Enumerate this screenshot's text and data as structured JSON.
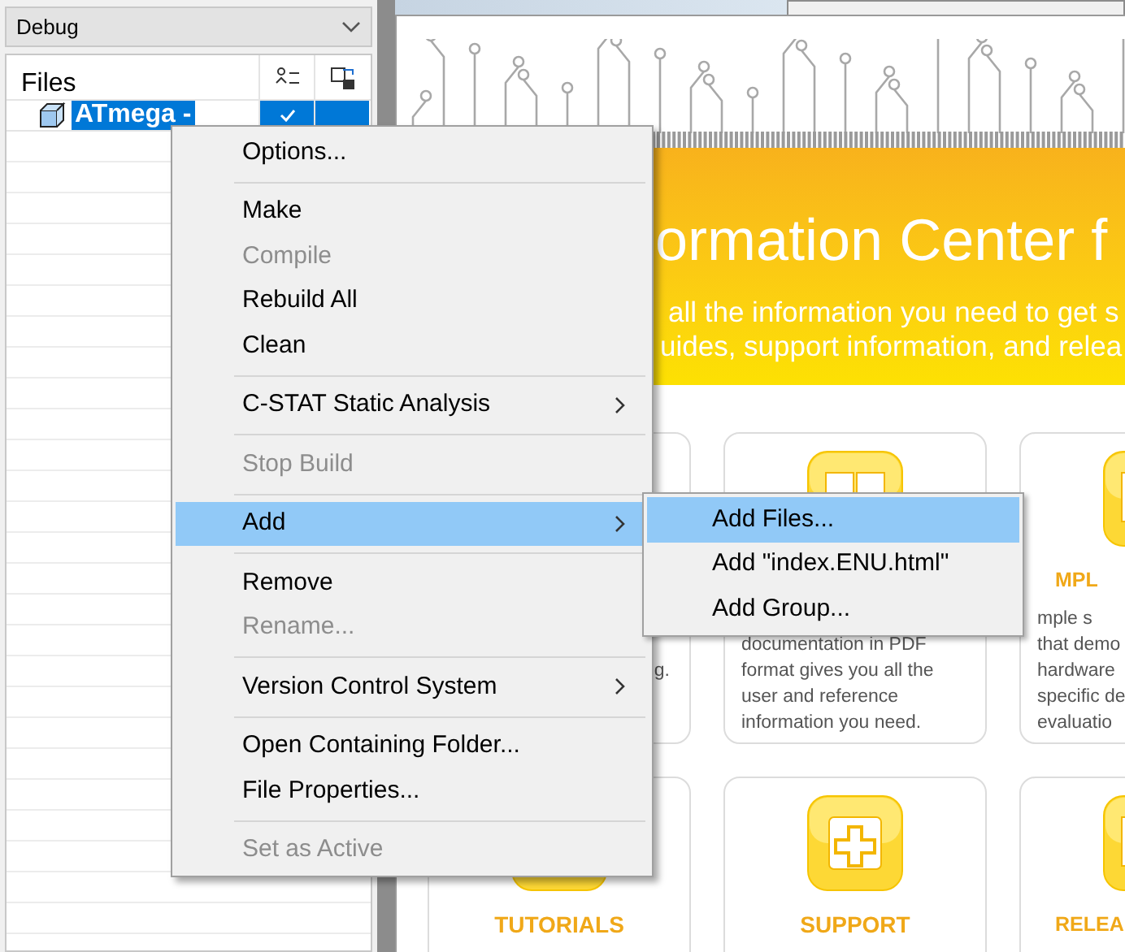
{
  "config_dropdown": {
    "value": "Debug"
  },
  "workspace": {
    "header": "Files",
    "rows": [
      {
        "name": "ATmega -",
        "selected": true,
        "checked": true
      }
    ]
  },
  "banner": {
    "title": "ormation Center f",
    "subtitle_lines": [
      "all the information you need to get s",
      "uides, support information, and relea"
    ]
  },
  "cards": [
    {
      "lines": [
        "g."
      ]
    },
    {
      "lines": [
        "documentation in PDF",
        "format gives you all the",
        "user and reference",
        "information you need."
      ]
    },
    {
      "title": "MPL",
      "lines": [
        "mple s",
        "that demo",
        "hardware",
        "specific de",
        "evaluatio"
      ]
    },
    {
      "title": "TUTORIALS"
    },
    {
      "title": "SUPPORT"
    },
    {
      "title": "RELEA"
    }
  ],
  "context_menu": {
    "items": [
      {
        "kind": "item",
        "label": "Options...",
        "disabled": false,
        "selected": false,
        "submenu": false
      },
      {
        "kind": "separator"
      },
      {
        "kind": "item",
        "label": "Make",
        "disabled": false,
        "selected": false,
        "submenu": false
      },
      {
        "kind": "item",
        "label": "Compile",
        "disabled": true,
        "selected": false,
        "submenu": false
      },
      {
        "kind": "item",
        "label": "Rebuild All",
        "disabled": false,
        "selected": false,
        "submenu": false
      },
      {
        "kind": "item",
        "label": "Clean",
        "disabled": false,
        "selected": false,
        "submenu": false
      },
      {
        "kind": "separator"
      },
      {
        "kind": "item",
        "label": "C-STAT Static Analysis",
        "disabled": false,
        "selected": false,
        "submenu": true
      },
      {
        "kind": "separator"
      },
      {
        "kind": "item",
        "label": "Stop Build",
        "disabled": true,
        "selected": false,
        "submenu": false
      },
      {
        "kind": "separator"
      },
      {
        "kind": "item",
        "label": "Add",
        "disabled": false,
        "selected": true,
        "submenu": true
      },
      {
        "kind": "separator"
      },
      {
        "kind": "item",
        "label": "Remove",
        "disabled": false,
        "selected": false,
        "submenu": false
      },
      {
        "kind": "item",
        "label": "Rename...",
        "disabled": true,
        "selected": false,
        "submenu": false
      },
      {
        "kind": "separator"
      },
      {
        "kind": "item",
        "label": "Version Control System",
        "disabled": false,
        "selected": false,
        "submenu": true
      },
      {
        "kind": "separator"
      },
      {
        "kind": "item",
        "label": "Open Containing Folder...",
        "disabled": false,
        "selected": false,
        "submenu": false
      },
      {
        "kind": "item",
        "label": "File Properties...",
        "disabled": false,
        "selected": false,
        "submenu": false
      },
      {
        "kind": "separator"
      },
      {
        "kind": "item",
        "label": "Set as Active",
        "disabled": true,
        "selected": false,
        "submenu": false
      }
    ]
  },
  "submenu": {
    "items": [
      {
        "label": "Add Files...",
        "selected": true
      },
      {
        "label": "Add \"index.ENU.html\"",
        "selected": false
      },
      {
        "label": "Add Group...",
        "selected": false
      }
    ]
  }
}
